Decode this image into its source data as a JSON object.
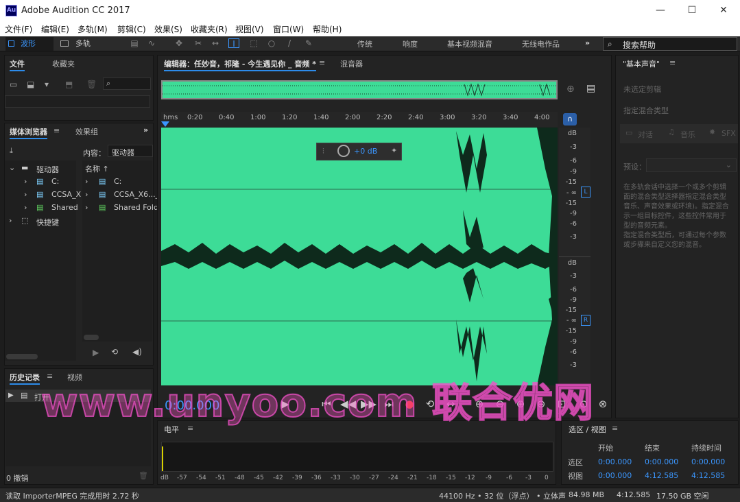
{
  "window": {
    "title": "Adobe Audition CC 2017",
    "icon_text": "Au",
    "minimize": "—",
    "maximize": "☐",
    "close": "✕"
  },
  "menu": [
    "文件(F)",
    "编辑(E)",
    "多轨(M)",
    "剪辑(C)",
    "效果(S)",
    "收藏夹(R)",
    "视图(V)",
    "窗口(W)",
    "帮助(H)"
  ],
  "toolbar": {
    "waveform": "波形",
    "multitrack": "多轨",
    "workspaces": [
      "传统",
      "响度",
      "基本视频混音",
      "无线电作品"
    ],
    "more": "»",
    "search_placeholder": "搜索帮助"
  },
  "files_panel": {
    "tabs": [
      "文件",
      "收藏夹"
    ]
  },
  "media_browser": {
    "tabs": [
      "媒体浏览器",
      "效果组"
    ],
    "content_label": "内容：",
    "content_value": "驱动器",
    "column_name": "名称 ↑",
    "tree": [
      "驱动器",
      "C:",
      "CCSA_X",
      "Shared",
      "快捷键"
    ],
    "list": [
      "C:",
      "CCSA_X6..._",
      "Shared Fold"
    ]
  },
  "history": {
    "tabs": [
      "历史记录",
      "视频"
    ],
    "item": "打开",
    "undo_count": "0 撤销"
  },
  "editor": {
    "tab": "编辑器：任妙音，祁隆 - 今生遇见你 _ 音频 *",
    "mixer_tab": "混音器",
    "gain": "+0 dB",
    "time_display": "0:00.000",
    "channel_L": "L",
    "channel_R": "R",
    "waveform_color": "#3ddc97"
  },
  "ruler": [
    "hms",
    "0:20",
    "0:40",
    "1:00",
    "1:20",
    "1:40",
    "2:00",
    "2:20",
    "2:40",
    "3:00",
    "3:20",
    "3:40",
    "4:00"
  ],
  "db_scale_L": [
    "dB",
    "-3",
    "-6",
    "-9",
    "-15",
    "- ∞",
    "-15",
    "-9",
    "-6",
    "-3"
  ],
  "db_scale_R": [
    "dB",
    "-3",
    "-6",
    "-9",
    "-15",
    "- ∞",
    "-15",
    "-9",
    "-6",
    "-3"
  ],
  "levels": {
    "title": "电平",
    "ticks": [
      "dB",
      "-57",
      "-54",
      "-51",
      "-48",
      "-45",
      "-42",
      "-39",
      "-36",
      "-33",
      "-30",
      "-27",
      "-24",
      "-21",
      "-18",
      "-15",
      "-12",
      "-9",
      "-6",
      "-3",
      "0"
    ]
  },
  "essential_sound": {
    "title": "\"基本声音\"",
    "no_clip": "未选定剪辑",
    "assign": "指定混合类型",
    "types": [
      "对话",
      "音乐",
      "SFX"
    ],
    "preset_label": "预设：",
    "description": [
      "在多轨会话中选择一个或多个剪辑",
      "面的混合类型选择器指定混合类型",
      "音乐、声音效果或环境)。指定混合",
      "示一组目标控件，这些控件常用于",
      "型的音频元素。",
      "指定混合类型后，可通过每个参数",
      "或步骤来自定义您的混音。"
    ]
  },
  "selection_view": {
    "title": "选区 / 视图",
    "headers": [
      "开始",
      "结束",
      "持续时间"
    ],
    "rows": [
      {
        "label": "选区",
        "start": "0:00.000",
        "end": "0:00.000",
        "duration": "0:00.000"
      },
      {
        "label": "视图",
        "start": "0:00.000",
        "end": "4:12.585",
        "duration": "4:12.585"
      }
    ]
  },
  "status_bar": {
    "message": "读取 ImporterMPEG 完成用时 2.72 秒",
    "format": "44100 Hz • 32 位（浮点） • 立体声",
    "size": "84.98 MB",
    "duration": "4:12.585",
    "free": "17.50 GB 空闲"
  },
  "watermark": "www.unyoo.com 联合优网"
}
